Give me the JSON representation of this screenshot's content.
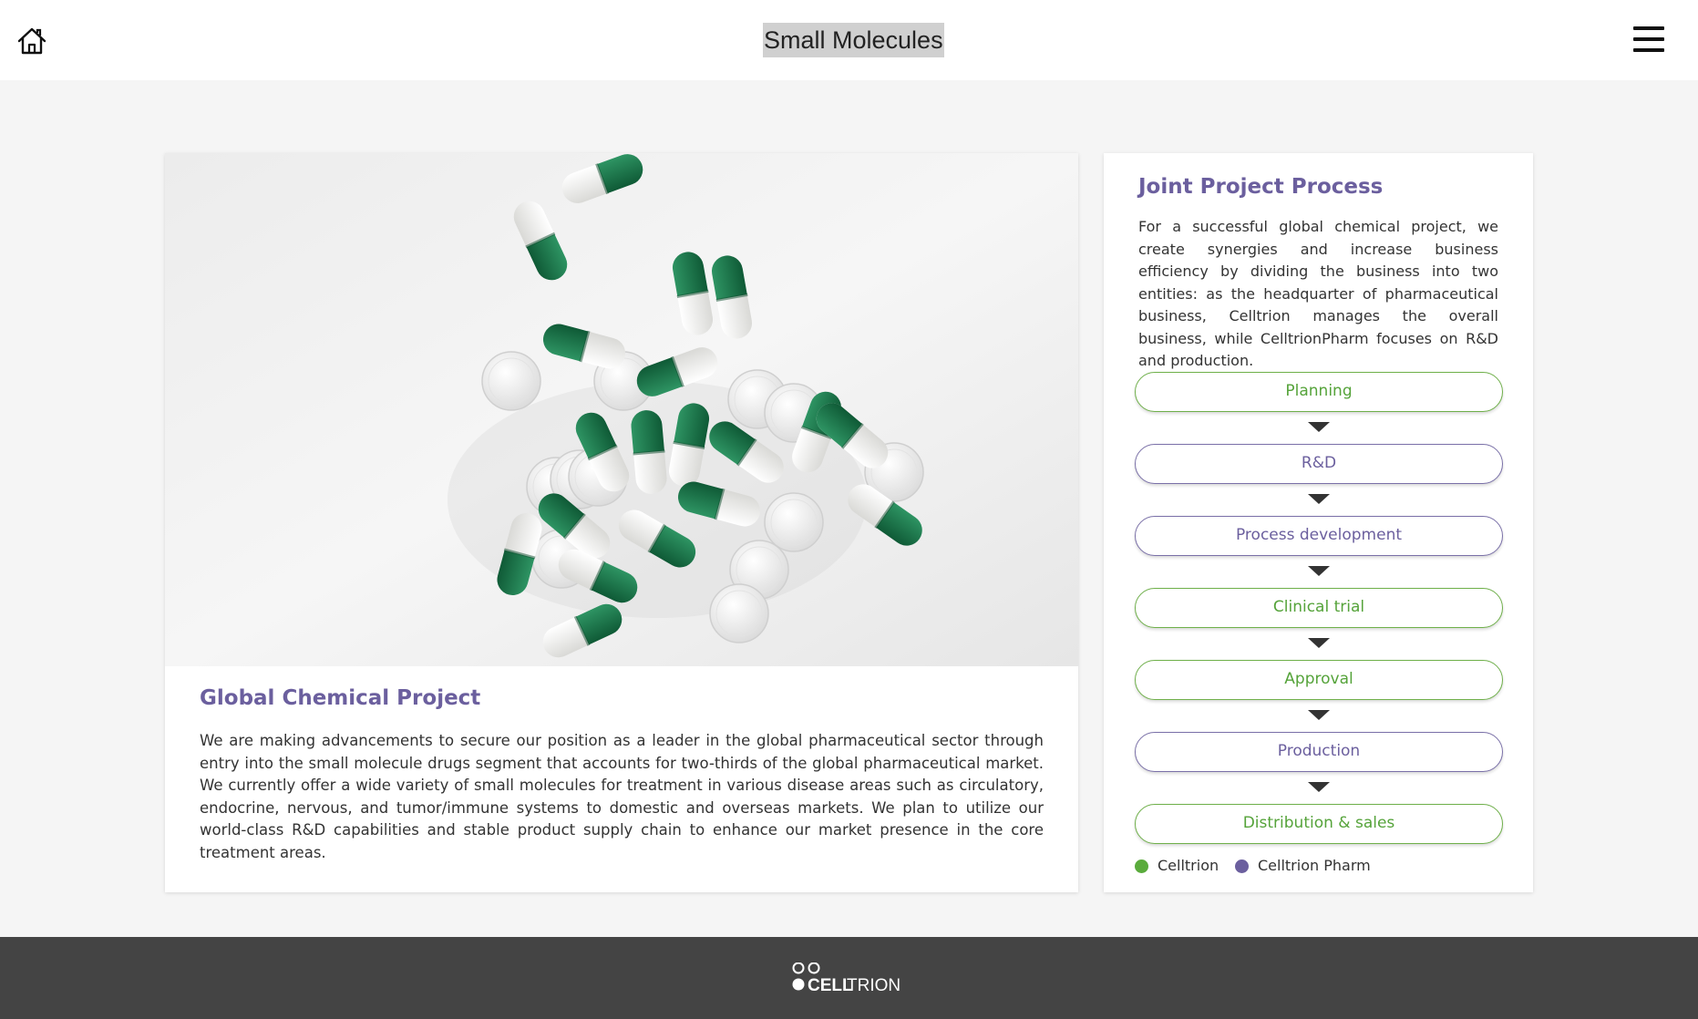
{
  "header": {
    "title": "Small Molecules",
    "home_icon": "home-icon",
    "menu_icon": "hamburger-menu-icon"
  },
  "global_project": {
    "heading": "Global Chemical Project",
    "text": "We are making advancements to secure our position as a leader in the global pharmaceutical sector through entry into the small molecule drugs segment that accounts for two-thirds of the global pharmaceutical market. We currently offer a wide variety of small molecules for treatment in various disease areas such as circulatory, endocrine, nervous, and tumor/immune systems to domestic and overseas markets. We plan to utilize our world-class R&D capabilities and stable product supply chain to enhance our market presence in the core treatment areas."
  },
  "joint_process": {
    "heading": "Joint Project Process",
    "text": "For a successful global chemical project, we create synergies and increase business efficiency by dividing the business into two entities: as the headquarter of pharmaceutical business, Celltrion manages the overall business, while CelltrionPharm focuses on R&D and production.",
    "steps": [
      {
        "label": "Planning",
        "entity": "Celltrion"
      },
      {
        "label": "R&D",
        "entity": "Celltrion Pharm"
      },
      {
        "label": "Process development",
        "entity": "Celltrion Pharm"
      },
      {
        "label": "Clinical trial",
        "entity": "Celltrion"
      },
      {
        "label": "Approval",
        "entity": "Celltrion"
      },
      {
        "label": "Production",
        "entity": "Celltrion Pharm"
      },
      {
        "label": "Distribution & sales",
        "entity": "Celltrion"
      }
    ],
    "legend": [
      {
        "label": "Celltrion",
        "color": "#5aab3c"
      },
      {
        "label": "Celltrion Pharm",
        "color": "#6b5f9e"
      }
    ]
  },
  "colors": {
    "purple": "#6b5f9e",
    "green": "#55a33a",
    "capsule_green": "#1f7a4c",
    "footer": "#444444"
  },
  "footer": {
    "logo_bold": "CELL",
    "logo_light": "TRION"
  }
}
